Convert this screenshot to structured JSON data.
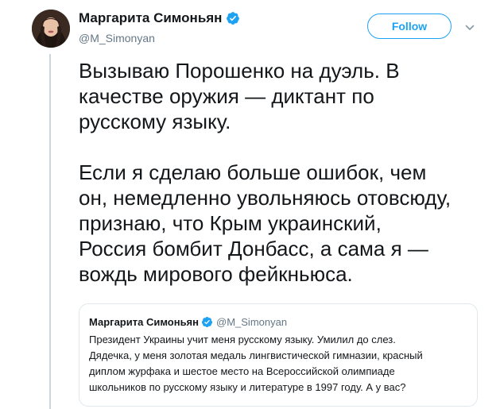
{
  "tweet": {
    "author": {
      "name": "Маргарита Симоньян",
      "handle": "@M_Simonyan",
      "verified": true
    },
    "follow_label": "Follow",
    "paragraphs": [
      "Вызываю Порошенко на дуэль. В\nкачестве оружия — диктант по\nрусскому языку.",
      "Если я сделаю больше ошибок, чем\nон, немедленно увольняюсь отовсюду,\nпризнаю, что Крым украинский,\nРоссия бомбит Донбасс, а сама я —\nвождь мирового фейкньюса."
    ]
  },
  "quoted_tweet": {
    "name": "Маргарита Симоньян",
    "handle": "@M_Simonyan",
    "verified": true,
    "text": "Президент Украины учит меня русскому языку. Умилил до слез.\nДядечка, у меня золотая медаль лингвистической гимназии, красный\nдиплом журфака и шестое место на Всероссийской олимпиаде\nшкольников по русскому языку и литературе в 1997 году. А у вас?"
  },
  "colors": {
    "accent": "#1da1f2",
    "secondary_text": "#657786",
    "border": "#e1e8ed",
    "thread_line": "#ccd6dd"
  },
  "icons": {
    "verified": "verified-badge-icon",
    "menu": "chevron-down-icon"
  }
}
